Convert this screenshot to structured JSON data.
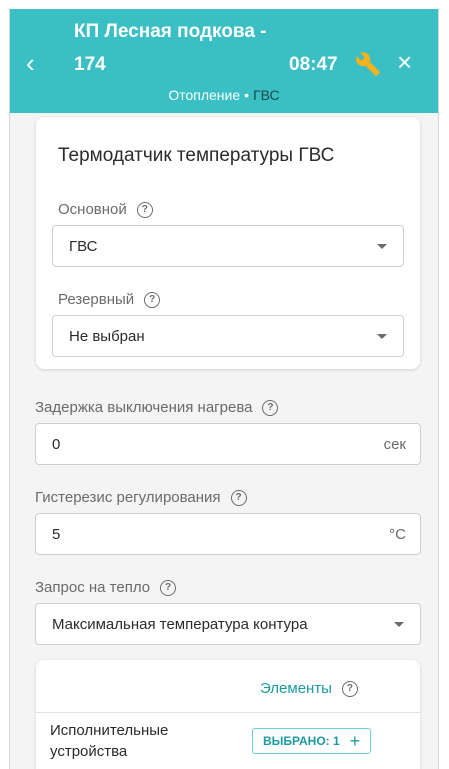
{
  "header": {
    "title": "КП Лесная подкова  -",
    "subtitle": "174",
    "time": "08:47",
    "back_icon": "‹",
    "close_icon": "×",
    "breadcrumb": {
      "parent": "Отопление",
      "separator": "•",
      "current": "ГВС"
    },
    "accent_color": "#39bfc4"
  },
  "sensor_card": {
    "title": "Термодатчик температуры ГВС",
    "primary": {
      "label": "Основной",
      "value": "ГВС"
    },
    "backup": {
      "label": "Резервный",
      "value": "Не выбран"
    }
  },
  "heating_delay": {
    "label": "Задержка выключения нагрева",
    "value": "0",
    "unit": "сек"
  },
  "hysteresis": {
    "label": "Гистерезис регулирования",
    "value": "5",
    "unit": "°C"
  },
  "heat_request": {
    "label": "Запрос на тепло",
    "value": "Максимальная температура контура"
  },
  "elements": {
    "title": "Элементы",
    "row_label": "Исполнительные устройства",
    "chip_label": "ВЫБРАНО: 1",
    "chip_icon": "+"
  },
  "help_icon": "?"
}
